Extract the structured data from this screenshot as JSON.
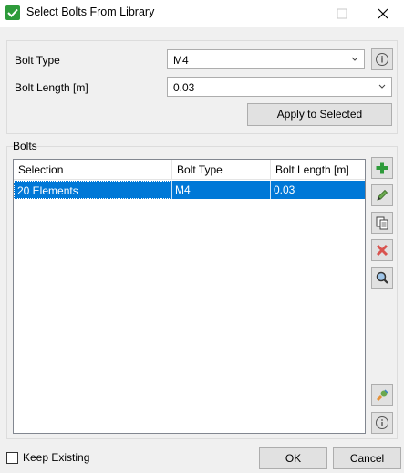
{
  "window": {
    "title": "Select Bolts From Library"
  },
  "form": {
    "bolt_type_label": "Bolt Type",
    "bolt_type_value": "M4",
    "bolt_length_label": "Bolt Length  [m]",
    "bolt_length_value": "0.03",
    "apply_label": "Apply to Selected"
  },
  "bolts": {
    "group_label": "Bolts",
    "columns": [
      "Selection",
      "Bolt Type",
      "Bolt Length  [m]"
    ],
    "rows": [
      {
        "selection": "20 Elements",
        "bolt_type": "M4",
        "bolt_length": "0.03"
      }
    ]
  },
  "footer": {
    "keep_existing_label": "Keep Existing",
    "keep_existing_checked": false,
    "ok_label": "OK",
    "cancel_label": "Cancel"
  },
  "colors": {
    "selection_blue": "#0078d7",
    "add_green": "#2e9b3b",
    "delete_red": "#d9534f"
  },
  "icons": {
    "title": "green-check-icon",
    "side_buttons": [
      "add-icon",
      "edit-icon",
      "copy-icon",
      "delete-icon",
      "zoom-icon",
      "pick-icon",
      "info-icon"
    ]
  }
}
